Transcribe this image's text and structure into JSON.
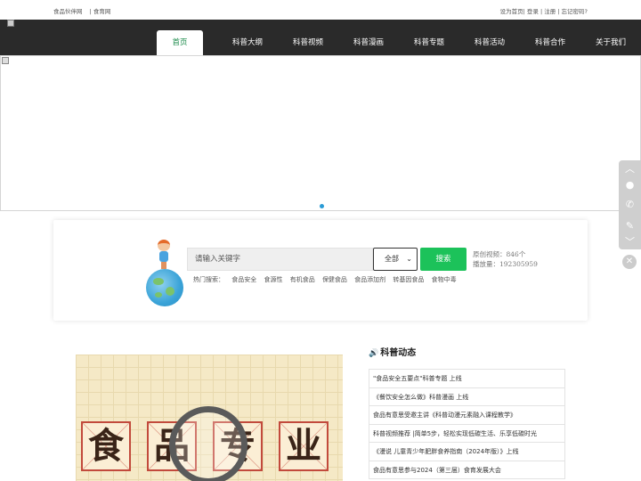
{
  "topbar": {
    "links_left": [
      "食品伙伴网",
      "| 食育网"
    ],
    "links_right": "设为首页| 登录 | 注册 | 忘记密码?"
  },
  "nav": {
    "items": [
      "首页",
      "科普大纲",
      "科普视频",
      "科普漫画",
      "科普专题",
      "科普活动",
      "科普合作",
      "关于我们"
    ],
    "active": "首页"
  },
  "search": {
    "placeholder": "请输入关键字",
    "select_value": "全部",
    "button": "搜索",
    "stats": [
      "原创视频：846个",
      "播放量：192305959"
    ],
    "hot_label": "热门搜索：",
    "hot_terms": [
      "食品安全",
      "食源性",
      "有机食品",
      "保健食品",
      "食品添加剂",
      "转基因食品",
      "食物中毒"
    ]
  },
  "poster": {
    "chars": [
      "食",
      "品",
      "专",
      "业"
    ]
  },
  "news": {
    "title": "科普动态",
    "items": [
      "\"食品安全五要点\"科普专题 上线",
      "《餐饮安全怎么做》科普漫画 上线",
      "食品有意思受邀主讲《科普动漫元素融入课程教学》",
      "科普视频推荐 |简单5步，轻松实现低碳生活、乐享低碳时光",
      "《漫说 儿童青少年肥胖食养指南（2024年版）》上线",
      "食品有意思参与2024（第三届）食育发展大会"
    ]
  },
  "colors": {
    "nav_bg": "#2a2a2a",
    "accent_green": "#1cc25a",
    "dot_blue": "#2a9bd6"
  }
}
